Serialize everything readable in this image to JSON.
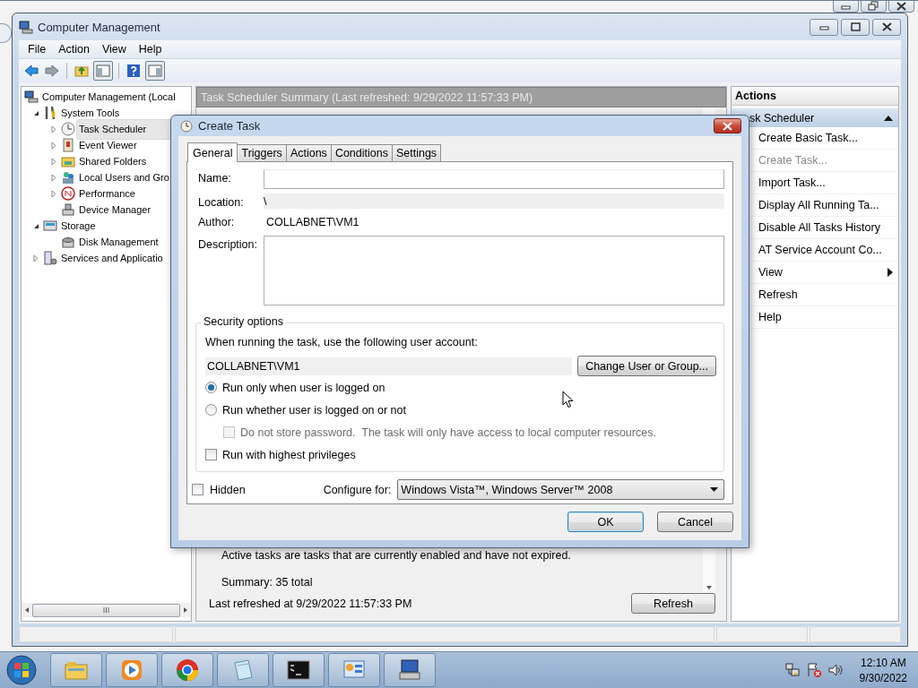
{
  "window": {
    "title": "Computer Management"
  },
  "menu": [
    "File",
    "Action",
    "View",
    "Help"
  ],
  "tree": [
    {
      "label": "Computer Management (Local",
      "expandable": false,
      "selected": false,
      "children": [
        {
          "label": "System Tools",
          "expandable": true,
          "expanded": true,
          "selected": false,
          "children": [
            {
              "label": "Task Scheduler",
              "expandable": true,
              "expanded": false,
              "selected": true
            },
            {
              "label": "Event Viewer",
              "expandable": true,
              "expanded": false,
              "selected": false
            },
            {
              "label": "Shared Folders",
              "expandable": true,
              "expanded": false,
              "selected": false
            },
            {
              "label": "Local Users and Gro",
              "expandable": true,
              "expanded": false,
              "selected": false
            },
            {
              "label": "Performance",
              "expandable": true,
              "expanded": false,
              "selected": false
            },
            {
              "label": "Device Manager",
              "expandable": false,
              "selected": false
            }
          ]
        },
        {
          "label": "Storage",
          "expandable": true,
          "expanded": true,
          "selected": false,
          "children": [
            {
              "label": "Disk Management",
              "expandable": false,
              "selected": false
            }
          ]
        },
        {
          "label": "Services and Applicatio",
          "expandable": true,
          "expanded": false,
          "selected": false
        }
      ]
    }
  ],
  "summary_pane": {
    "title": "Task Scheduler Summary (Last refreshed: 9/29/2022 11:57:33 PM)",
    "lines": [
      "Active tasks are tasks that are currently enabled and have not expired.",
      "Summary: 35 total"
    ],
    "last_refreshed": "Last refreshed at 9/29/2022 11:57:33 PM",
    "refresh_button": "Refresh"
  },
  "actions": {
    "title": "Actions",
    "section": "sk Scheduler",
    "expanded": true,
    "items": [
      {
        "label": "Create Basic Task...",
        "disabled": false,
        "submenu": false
      },
      {
        "label": "Create Task...",
        "disabled": true,
        "submenu": false
      },
      {
        "label": "Import Task...",
        "disabled": false,
        "submenu": false
      },
      {
        "label": "Display All Running Ta...",
        "disabled": false,
        "submenu": false
      },
      {
        "label": "Disable All Tasks History",
        "disabled": false,
        "submenu": false
      },
      {
        "label": "AT Service Account Co...",
        "disabled": false,
        "submenu": false
      },
      {
        "label": "View",
        "disabled": false,
        "submenu": true
      },
      {
        "label": "Refresh",
        "disabled": false,
        "submenu": false
      },
      {
        "label": "Help",
        "disabled": false,
        "submenu": false
      }
    ]
  },
  "dialog": {
    "title": "Create Task",
    "tabs": [
      {
        "label": "General",
        "selected": true
      },
      {
        "label": "Triggers",
        "selected": false
      },
      {
        "label": "Actions",
        "selected": false
      },
      {
        "label": "Conditions",
        "selected": false
      },
      {
        "label": "Settings",
        "selected": false
      }
    ],
    "fields": [
      {
        "label": "Name:",
        "kind": "input"
      },
      {
        "label": "Location:",
        "kind": "readonly",
        "value": "\\"
      },
      {
        "label": "Author:",
        "kind": "text",
        "value": "COLLABNET\\VM1"
      },
      {
        "label": "Description:",
        "kind": "textarea"
      }
    ],
    "security": {
      "legend": "Security options",
      "prompt": "When running the task, use the following user account:",
      "account": "COLLABNET\\VM1",
      "change_button": "Change User or Group...",
      "options": [
        {
          "kind": "radio",
          "label": "Run only when user is logged on",
          "selected": true,
          "disabled": false
        },
        {
          "kind": "radio",
          "label": "Run whether user is logged on or not",
          "selected": false,
          "disabled": false,
          "children": [
            {
              "kind": "checkbox",
              "label": "Do not store password.  The task will only have access to local computer resources.",
              "checked": false,
              "disabled": true
            }
          ]
        },
        {
          "kind": "checkbox",
          "label": "Run with highest privileges",
          "checked": false,
          "disabled": false
        }
      ]
    },
    "hidden": {
      "label": "Hidden",
      "checked": false
    },
    "configure_for": {
      "label": "Configure for:",
      "value": "Windows Vista™, Windows Server™ 2008"
    },
    "buttons": [
      {
        "label": "OK",
        "default": true
      },
      {
        "label": "Cancel",
        "default": false
      }
    ]
  },
  "taskbar": {
    "time": "12:10 AM",
    "date": "9/30/2022"
  }
}
